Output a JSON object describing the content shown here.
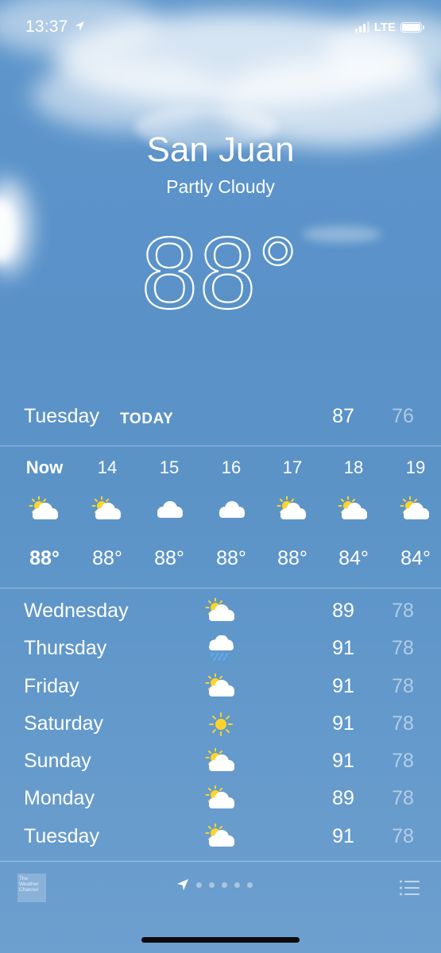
{
  "status_bar": {
    "time": "13:37",
    "network": "LTE",
    "location_icon": "location-arrow-icon",
    "signal_icon": "signal-bars-icon",
    "battery_icon": "battery-icon"
  },
  "location": {
    "city": "San Juan",
    "condition": "Partly Cloudy",
    "temperature": "88°"
  },
  "today": {
    "day": "Tuesday",
    "label": "TODAY",
    "high": "87",
    "low": "76"
  },
  "hourly": [
    {
      "time": "Now",
      "icon": "partly-cloudy-icon",
      "temp": "88°"
    },
    {
      "time": "14",
      "icon": "partly-cloudy-icon",
      "temp": "88°"
    },
    {
      "time": "15",
      "icon": "cloud-icon",
      "temp": "88°"
    },
    {
      "time": "16",
      "icon": "cloud-icon",
      "temp": "88°"
    },
    {
      "time": "17",
      "icon": "partly-cloudy-icon",
      "temp": "88°"
    },
    {
      "time": "18",
      "icon": "partly-cloudy-icon",
      "temp": "84°"
    },
    {
      "time": "19",
      "icon": "partly-cloudy-icon",
      "temp": "84°"
    }
  ],
  "daily": [
    {
      "day": "Wednesday",
      "icon": "partly-cloudy-icon",
      "high": "89",
      "low": "78"
    },
    {
      "day": "Thursday",
      "icon": "rain-cloud-icon",
      "high": "91",
      "low": "78"
    },
    {
      "day": "Friday",
      "icon": "partly-cloudy-icon",
      "high": "91",
      "low": "78"
    },
    {
      "day": "Saturday",
      "icon": "sun-icon",
      "high": "91",
      "low": "78"
    },
    {
      "day": "Sunday",
      "icon": "partly-cloudy-icon",
      "high": "91",
      "low": "78"
    },
    {
      "day": "Monday",
      "icon": "partly-cloudy-icon",
      "high": "89",
      "low": "78"
    },
    {
      "day": "Tuesday",
      "icon": "partly-cloudy-icon",
      "high": "91",
      "low": "78"
    }
  ],
  "footer": {
    "logo_text": "The Weather Channel",
    "logo_icon": "weather-channel-logo-icon",
    "page_count": 5,
    "current_page_icon": "location-arrow-icon",
    "list_icon": "list-icon"
  },
  "colors": {
    "sun": "#ffd42a",
    "cloud": "#ffffff",
    "rain": "#5aaef5",
    "low_temp_text": "rgba(255,255,255,0.5)"
  }
}
